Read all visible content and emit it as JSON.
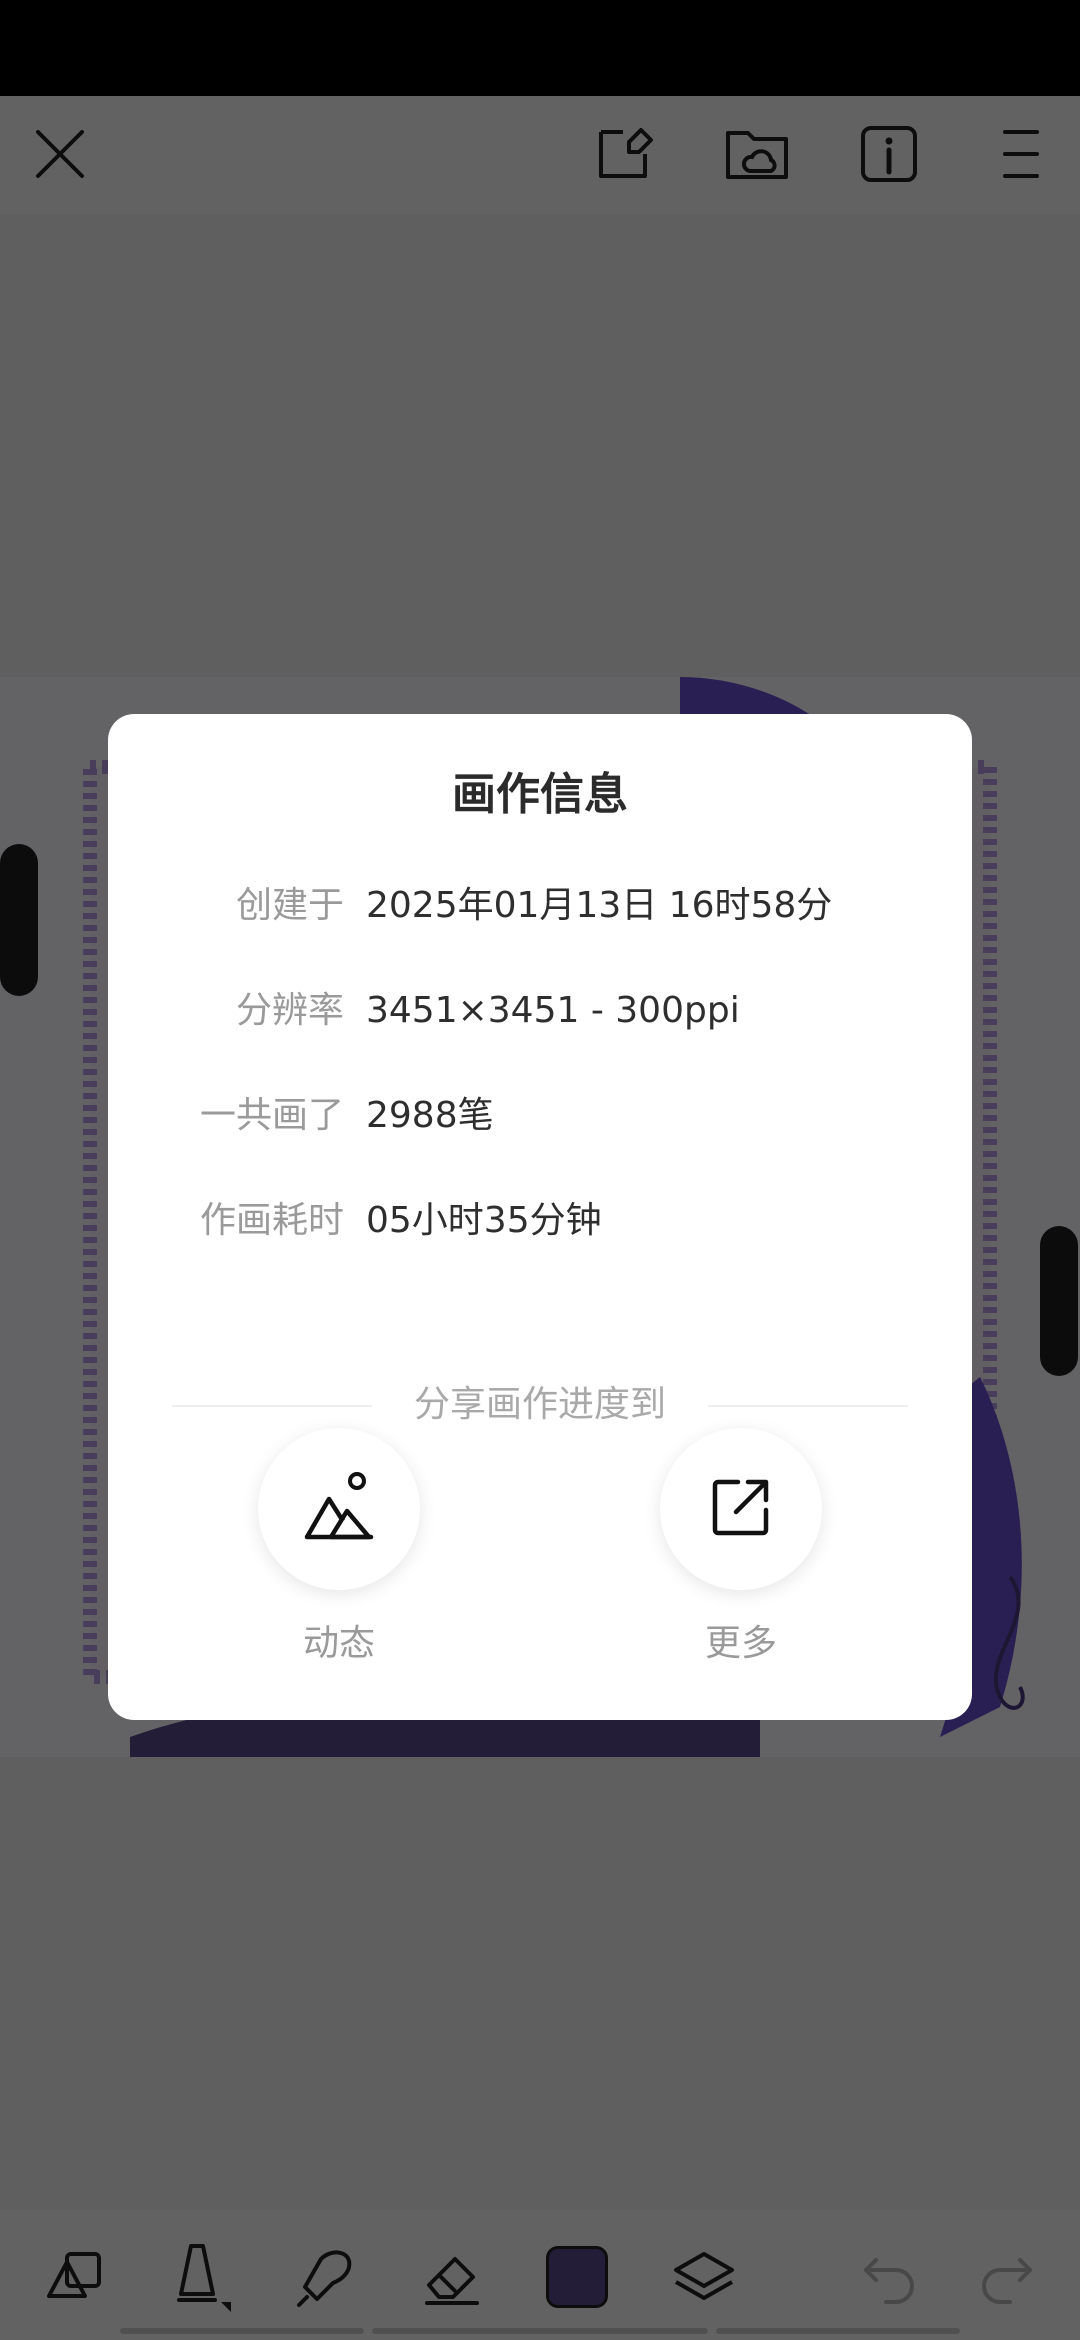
{
  "dialog": {
    "title": "画作信息",
    "rows": [
      {
        "label": "创建于",
        "value": "2025年01月13日 16时58分"
      },
      {
        "label": "分辨率",
        "value": "3451×3451 - 300ppi"
      },
      {
        "label": "一共画了",
        "value": "2988笔"
      },
      {
        "label": "作画耗时",
        "value": "05小时35分钟"
      }
    ],
    "share_heading": "分享画作进度到",
    "share_options": [
      {
        "label": "动态",
        "icon": "mountain-image-icon"
      },
      {
        "label": "更多",
        "icon": "external-share-icon"
      }
    ]
  },
  "top_toolbar": {
    "icons": [
      "close-icon",
      "canvas-edit-icon",
      "cloud-folder-icon",
      "info-icon",
      "menu-icon"
    ]
  },
  "bottom_toolbar": {
    "icons": [
      "shapes-icon",
      "brush-icon",
      "smudge-icon",
      "eraser-icon",
      "color-swatch",
      "layers-icon",
      "undo-icon",
      "redo-icon"
    ],
    "current_color": "#5b4a8a"
  },
  "colors": {
    "accent_purple": "#6a4fcf",
    "overlay": "rgba(0,0,0,0.6)"
  }
}
